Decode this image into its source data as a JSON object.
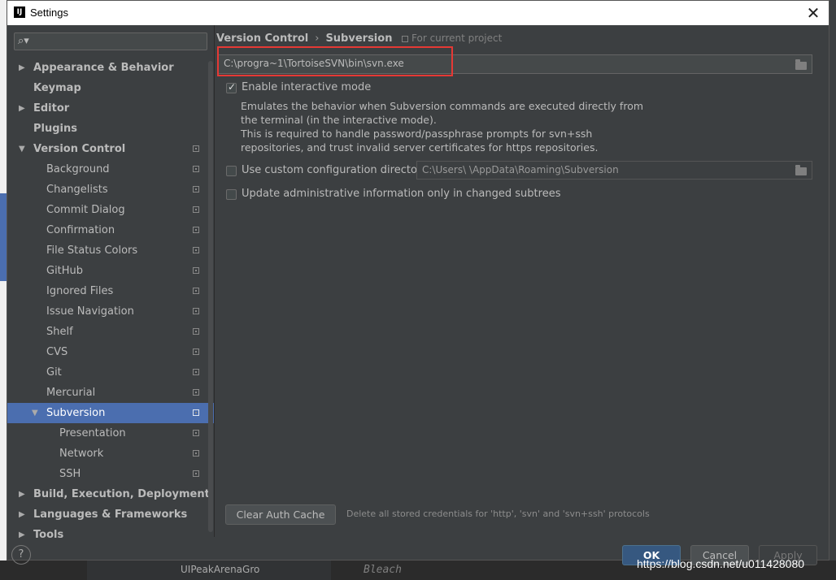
{
  "window": {
    "title": "Settings",
    "app_icon": "intellij-icon"
  },
  "search": {
    "placeholder": ""
  },
  "sidebar": {
    "items": [
      {
        "label": "Appearance & Behavior",
        "level": 0,
        "arrow": "▶",
        "bold": true,
        "proj": false
      },
      {
        "label": "Keymap",
        "level": 0,
        "arrow": "",
        "bold": true,
        "proj": false
      },
      {
        "label": "Editor",
        "level": 0,
        "arrow": "▶",
        "bold": true,
        "proj": false
      },
      {
        "label": "Plugins",
        "level": 0,
        "arrow": "",
        "bold": true,
        "proj": false
      },
      {
        "label": "Version Control",
        "level": 0,
        "arrow": "▼",
        "bold": true,
        "proj": true
      },
      {
        "label": "Background",
        "level": 1,
        "arrow": "",
        "bold": false,
        "proj": true
      },
      {
        "label": "Changelists",
        "level": 1,
        "arrow": "",
        "bold": false,
        "proj": true
      },
      {
        "label": "Commit Dialog",
        "level": 1,
        "arrow": "",
        "bold": false,
        "proj": true
      },
      {
        "label": "Confirmation",
        "level": 1,
        "arrow": "",
        "bold": false,
        "proj": true
      },
      {
        "label": "File Status Colors",
        "level": 1,
        "arrow": "",
        "bold": false,
        "proj": true
      },
      {
        "label": "GitHub",
        "level": 1,
        "arrow": "",
        "bold": false,
        "proj": true
      },
      {
        "label": "Ignored Files",
        "level": 1,
        "arrow": "",
        "bold": false,
        "proj": true
      },
      {
        "label": "Issue Navigation",
        "level": 1,
        "arrow": "",
        "bold": false,
        "proj": true
      },
      {
        "label": "Shelf",
        "level": 1,
        "arrow": "",
        "bold": false,
        "proj": true
      },
      {
        "label": "CVS",
        "level": 1,
        "arrow": "",
        "bold": false,
        "proj": true
      },
      {
        "label": "Git",
        "level": 1,
        "arrow": "",
        "bold": false,
        "proj": true
      },
      {
        "label": "Mercurial",
        "level": 1,
        "arrow": "",
        "bold": false,
        "proj": true
      },
      {
        "label": "Subversion",
        "level": 1,
        "arrow": "▼",
        "bold": false,
        "proj": true,
        "selected": true
      },
      {
        "label": "Presentation",
        "level": 2,
        "arrow": "",
        "bold": false,
        "proj": true
      },
      {
        "label": "Network",
        "level": 2,
        "arrow": "",
        "bold": false,
        "proj": true
      },
      {
        "label": "SSH",
        "level": 2,
        "arrow": "",
        "bold": false,
        "proj": true
      },
      {
        "label": "Build, Execution, Deployment",
        "level": 0,
        "arrow": "▶",
        "bold": true,
        "proj": false
      },
      {
        "label": "Languages & Frameworks",
        "level": 0,
        "arrow": "▶",
        "bold": true,
        "proj": false
      },
      {
        "label": "Tools",
        "level": 0,
        "arrow": "▶",
        "bold": true,
        "proj": false
      }
    ]
  },
  "breadcrumb": {
    "part1": "Version Control",
    "separator": "›",
    "part2": "Subversion",
    "scope": "For current project"
  },
  "svn_path": {
    "value": "C:\\progra~1\\TortoiseSVN\\bin\\svn.exe"
  },
  "interactive": {
    "label": "Enable interactive mode",
    "checked": true,
    "description": [
      "Emulates the behavior when Subversion commands are executed directly from",
      "the terminal (in the interactive mode).",
      "This is required to handle password/passphrase prompts for svn+ssh",
      "repositories, and trust invalid server certificates for https repositories."
    ]
  },
  "custom_dir": {
    "label": "Use custom configuration directory:",
    "value": "C:\\Users\\       \\AppData\\Roaming\\Subversion",
    "checked": false
  },
  "update_admin": {
    "label": "Update administrative information only in changed subtrees",
    "checked": false
  },
  "auth": {
    "button_label": "Clear Auth Cache",
    "description": "Delete all stored credentials for 'http', 'svn' and 'svn+ssh' protocols"
  },
  "footer": {
    "help": "?",
    "ok": "OK",
    "cancel": "Cancel",
    "apply": "Apply"
  },
  "watermark": "https://blog.csdn.net/u011428080",
  "background": {
    "tab_label": "UIPeakArenaGro",
    "code_text": "Bleach"
  },
  "colors": {
    "selection": "#4b6eaf",
    "highlight": "#e53935",
    "ok_button": "#365880"
  }
}
